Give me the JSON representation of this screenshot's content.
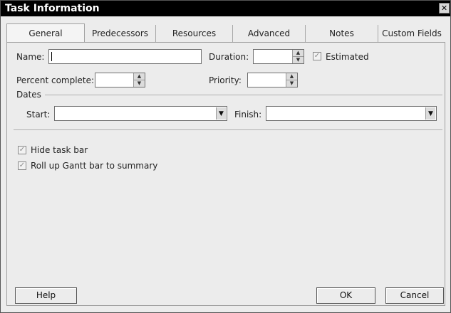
{
  "window": {
    "title": "Task Information",
    "close_glyph": "✕"
  },
  "tabs": [
    {
      "label": "General",
      "active": true
    },
    {
      "label": "Predecessors"
    },
    {
      "label": "Resources"
    },
    {
      "label": "Advanced"
    },
    {
      "label": "Notes"
    },
    {
      "label": "Custom Fields"
    }
  ],
  "general": {
    "name_label": "Name:",
    "name_value": "",
    "duration_label": "Duration:",
    "duration_value": "",
    "estimated_label": "Estimated",
    "estimated_checked": true,
    "percent_label": "Percent complete:",
    "percent_value": "",
    "priority_label": "Priority:",
    "priority_value": "",
    "dates_label": "Dates",
    "start_label": "Start:",
    "start_value": "",
    "finish_label": "Finish:",
    "finish_value": "",
    "hide_taskbar_label": "Hide task bar",
    "hide_taskbar_checked": true,
    "rollup_label": "Roll up Gantt bar to summary",
    "rollup_checked": true
  },
  "buttons": {
    "help": "Help",
    "ok": "OK",
    "cancel": "Cancel"
  },
  "glyphs": {
    "check": "✓",
    "spin_up": "▲",
    "spin_down": "▼",
    "dropdown": "▼"
  }
}
